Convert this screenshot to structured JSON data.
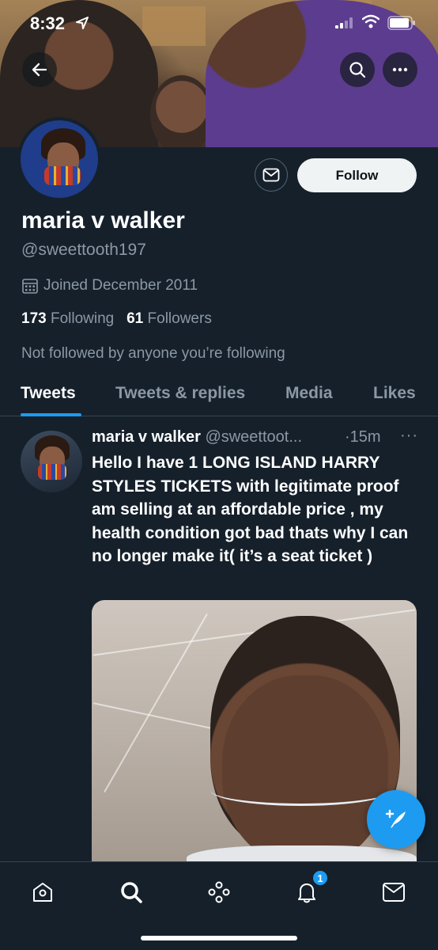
{
  "status_bar": {
    "time": "8:32"
  },
  "profile": {
    "name": "maria v walker",
    "handle": "@sweettooth197",
    "joined": "Joined December 2011",
    "following_count": "173",
    "following_label": "Following",
    "followers_count": "61",
    "followers_label": "Followers",
    "follow_context": "Not followed by anyone you’re following",
    "follow_button": "Follow"
  },
  "tabs": [
    {
      "label": "Tweets",
      "active": true
    },
    {
      "label": "Tweets & replies",
      "active": false
    },
    {
      "label": "Media",
      "active": false
    },
    {
      "label": "Likes",
      "active": false
    }
  ],
  "tweet": {
    "name": "maria v walker",
    "handle": "@sweettoot...",
    "time": "·15m",
    "more": "···",
    "text": "Hello I have 1 LONG ISLAND HARRY STYLES TICKETS with legitimate proof am selling at an  affordable price , my health condition got bad thats why I can no longer make it( it’s a seat ticket )"
  },
  "notifications_badge": "1",
  "colors": {
    "background": "#15202b",
    "accent": "#1d9bf0",
    "secondary_text": "#8b98a5"
  },
  "icons": {
    "back": "back-arrow-icon",
    "search": "search-icon",
    "more": "more-icon",
    "mail": "mail-icon",
    "calendar": "calendar-icon",
    "compose": "compose-icon",
    "home": "home-icon",
    "explore": "search-icon",
    "spaces": "spaces-icon",
    "notifications": "bell-icon",
    "messages": "envelope-icon"
  }
}
